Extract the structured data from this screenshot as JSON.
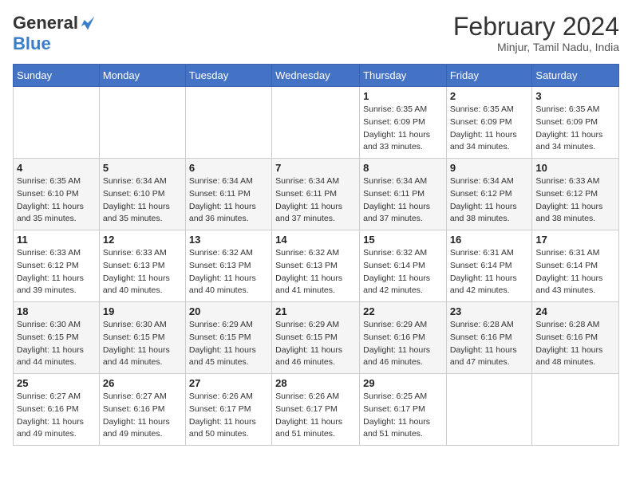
{
  "header": {
    "logo_general": "General",
    "logo_blue": "Blue",
    "month_year": "February 2024",
    "location": "Minjur, Tamil Nadu, India"
  },
  "calendar": {
    "days_of_week": [
      "Sunday",
      "Monday",
      "Tuesday",
      "Wednesday",
      "Thursday",
      "Friday",
      "Saturday"
    ],
    "weeks": [
      [
        {
          "day": "",
          "sunrise": "",
          "sunset": "",
          "daylight": ""
        },
        {
          "day": "",
          "sunrise": "",
          "sunset": "",
          "daylight": ""
        },
        {
          "day": "",
          "sunrise": "",
          "sunset": "",
          "daylight": ""
        },
        {
          "day": "",
          "sunrise": "",
          "sunset": "",
          "daylight": ""
        },
        {
          "day": "1",
          "sunrise": "Sunrise: 6:35 AM",
          "sunset": "Sunset: 6:09 PM",
          "daylight": "Daylight: 11 hours and 33 minutes."
        },
        {
          "day": "2",
          "sunrise": "Sunrise: 6:35 AM",
          "sunset": "Sunset: 6:09 PM",
          "daylight": "Daylight: 11 hours and 34 minutes."
        },
        {
          "day": "3",
          "sunrise": "Sunrise: 6:35 AM",
          "sunset": "Sunset: 6:09 PM",
          "daylight": "Daylight: 11 hours and 34 minutes."
        }
      ],
      [
        {
          "day": "4",
          "sunrise": "Sunrise: 6:35 AM",
          "sunset": "Sunset: 6:10 PM",
          "daylight": "Daylight: 11 hours and 35 minutes."
        },
        {
          "day": "5",
          "sunrise": "Sunrise: 6:34 AM",
          "sunset": "Sunset: 6:10 PM",
          "daylight": "Daylight: 11 hours and 35 minutes."
        },
        {
          "day": "6",
          "sunrise": "Sunrise: 6:34 AM",
          "sunset": "Sunset: 6:11 PM",
          "daylight": "Daylight: 11 hours and 36 minutes."
        },
        {
          "day": "7",
          "sunrise": "Sunrise: 6:34 AM",
          "sunset": "Sunset: 6:11 PM",
          "daylight": "Daylight: 11 hours and 37 minutes."
        },
        {
          "day": "8",
          "sunrise": "Sunrise: 6:34 AM",
          "sunset": "Sunset: 6:11 PM",
          "daylight": "Daylight: 11 hours and 37 minutes."
        },
        {
          "day": "9",
          "sunrise": "Sunrise: 6:34 AM",
          "sunset": "Sunset: 6:12 PM",
          "daylight": "Daylight: 11 hours and 38 minutes."
        },
        {
          "day": "10",
          "sunrise": "Sunrise: 6:33 AM",
          "sunset": "Sunset: 6:12 PM",
          "daylight": "Daylight: 11 hours and 38 minutes."
        }
      ],
      [
        {
          "day": "11",
          "sunrise": "Sunrise: 6:33 AM",
          "sunset": "Sunset: 6:12 PM",
          "daylight": "Daylight: 11 hours and 39 minutes."
        },
        {
          "day": "12",
          "sunrise": "Sunrise: 6:33 AM",
          "sunset": "Sunset: 6:13 PM",
          "daylight": "Daylight: 11 hours and 40 minutes."
        },
        {
          "day": "13",
          "sunrise": "Sunrise: 6:32 AM",
          "sunset": "Sunset: 6:13 PM",
          "daylight": "Daylight: 11 hours and 40 minutes."
        },
        {
          "day": "14",
          "sunrise": "Sunrise: 6:32 AM",
          "sunset": "Sunset: 6:13 PM",
          "daylight": "Daylight: 11 hours and 41 minutes."
        },
        {
          "day": "15",
          "sunrise": "Sunrise: 6:32 AM",
          "sunset": "Sunset: 6:14 PM",
          "daylight": "Daylight: 11 hours and 42 minutes."
        },
        {
          "day": "16",
          "sunrise": "Sunrise: 6:31 AM",
          "sunset": "Sunset: 6:14 PM",
          "daylight": "Daylight: 11 hours and 42 minutes."
        },
        {
          "day": "17",
          "sunrise": "Sunrise: 6:31 AM",
          "sunset": "Sunset: 6:14 PM",
          "daylight": "Daylight: 11 hours and 43 minutes."
        }
      ],
      [
        {
          "day": "18",
          "sunrise": "Sunrise: 6:30 AM",
          "sunset": "Sunset: 6:15 PM",
          "daylight": "Daylight: 11 hours and 44 minutes."
        },
        {
          "day": "19",
          "sunrise": "Sunrise: 6:30 AM",
          "sunset": "Sunset: 6:15 PM",
          "daylight": "Daylight: 11 hours and 44 minutes."
        },
        {
          "day": "20",
          "sunrise": "Sunrise: 6:29 AM",
          "sunset": "Sunset: 6:15 PM",
          "daylight": "Daylight: 11 hours and 45 minutes."
        },
        {
          "day": "21",
          "sunrise": "Sunrise: 6:29 AM",
          "sunset": "Sunset: 6:15 PM",
          "daylight": "Daylight: 11 hours and 46 minutes."
        },
        {
          "day": "22",
          "sunrise": "Sunrise: 6:29 AM",
          "sunset": "Sunset: 6:16 PM",
          "daylight": "Daylight: 11 hours and 46 minutes."
        },
        {
          "day": "23",
          "sunrise": "Sunrise: 6:28 AM",
          "sunset": "Sunset: 6:16 PM",
          "daylight": "Daylight: 11 hours and 47 minutes."
        },
        {
          "day": "24",
          "sunrise": "Sunrise: 6:28 AM",
          "sunset": "Sunset: 6:16 PM",
          "daylight": "Daylight: 11 hours and 48 minutes."
        }
      ],
      [
        {
          "day": "25",
          "sunrise": "Sunrise: 6:27 AM",
          "sunset": "Sunset: 6:16 PM",
          "daylight": "Daylight: 11 hours and 49 minutes."
        },
        {
          "day": "26",
          "sunrise": "Sunrise: 6:27 AM",
          "sunset": "Sunset: 6:16 PM",
          "daylight": "Daylight: 11 hours and 49 minutes."
        },
        {
          "day": "27",
          "sunrise": "Sunrise: 6:26 AM",
          "sunset": "Sunset: 6:17 PM",
          "daylight": "Daylight: 11 hours and 50 minutes."
        },
        {
          "day": "28",
          "sunrise": "Sunrise: 6:26 AM",
          "sunset": "Sunset: 6:17 PM",
          "daylight": "Daylight: 11 hours and 51 minutes."
        },
        {
          "day": "29",
          "sunrise": "Sunrise: 6:25 AM",
          "sunset": "Sunset: 6:17 PM",
          "daylight": "Daylight: 11 hours and 51 minutes."
        },
        {
          "day": "",
          "sunrise": "",
          "sunset": "",
          "daylight": ""
        },
        {
          "day": "",
          "sunrise": "",
          "sunset": "",
          "daylight": ""
        }
      ]
    ]
  }
}
